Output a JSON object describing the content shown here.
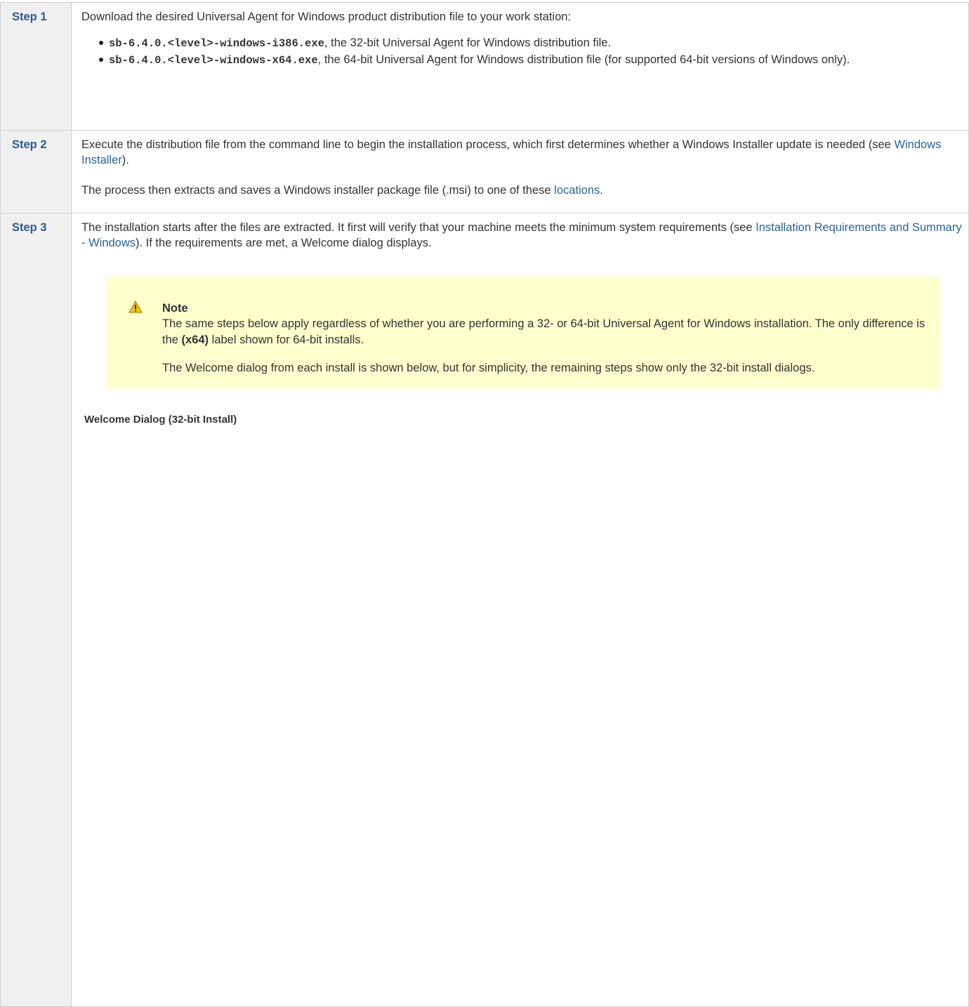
{
  "steps": [
    {
      "label": "Step 1",
      "intro": "Download the desired Universal Agent for Windows product distribution file to your work station:",
      "files": [
        {
          "name": "sb-6.4.0.<level>-windows-i386.exe",
          "desc": ", the 32-bit Universal Agent for Windows distribution file."
        },
        {
          "name": "sb-6.4.0.<level>-windows-x64.exe",
          "desc": ", the 64-bit Universal Agent for Windows distribution file (for supported 64-bit versions of Windows only)."
        }
      ]
    },
    {
      "label": "Step 2",
      "p1_before": "Execute the distribution file from the command line to begin the installation process, which first determines whether a Windows Installer update is needed (see ",
      "p1_link": "Windows Installer",
      "p1_after": ").",
      "p2_before": "The process then extracts and saves a Windows installer package file (.msi) to one of these ",
      "p2_link": "locations",
      "p2_after": "."
    },
    {
      "label": "Step 3",
      "p1_before": "The installation starts after the files are extracted. It first will verify that your machine meets the minimum system requirements (see ",
      "p1_link": "Installation Requirements and Summary - Windows",
      "p1_after": "). If the requirements are met, a Welcome dialog displays.",
      "note": {
        "title": "Note",
        "p1_before": "The same steps below apply regardless of whether you are performing a 32- or 64-bit Universal Agent for Windows installation. The only difference is the ",
        "p1_bold": "(x64)",
        "p1_after": " label shown for 64-bit installs.",
        "p2": "The Welcome dialog from each install is shown below, but for simplicity, the remaining steps show only the 32-bit install dialogs."
      },
      "welcome_caption": "Welcome Dialog (32-bit Install)"
    }
  ],
  "colors": {
    "step_label": "#2b5c8a",
    "link": "#2a6496",
    "note_bg": "#ffffce",
    "warning": "#f0c419"
  },
  "icons": {
    "note": "warning-icon"
  }
}
